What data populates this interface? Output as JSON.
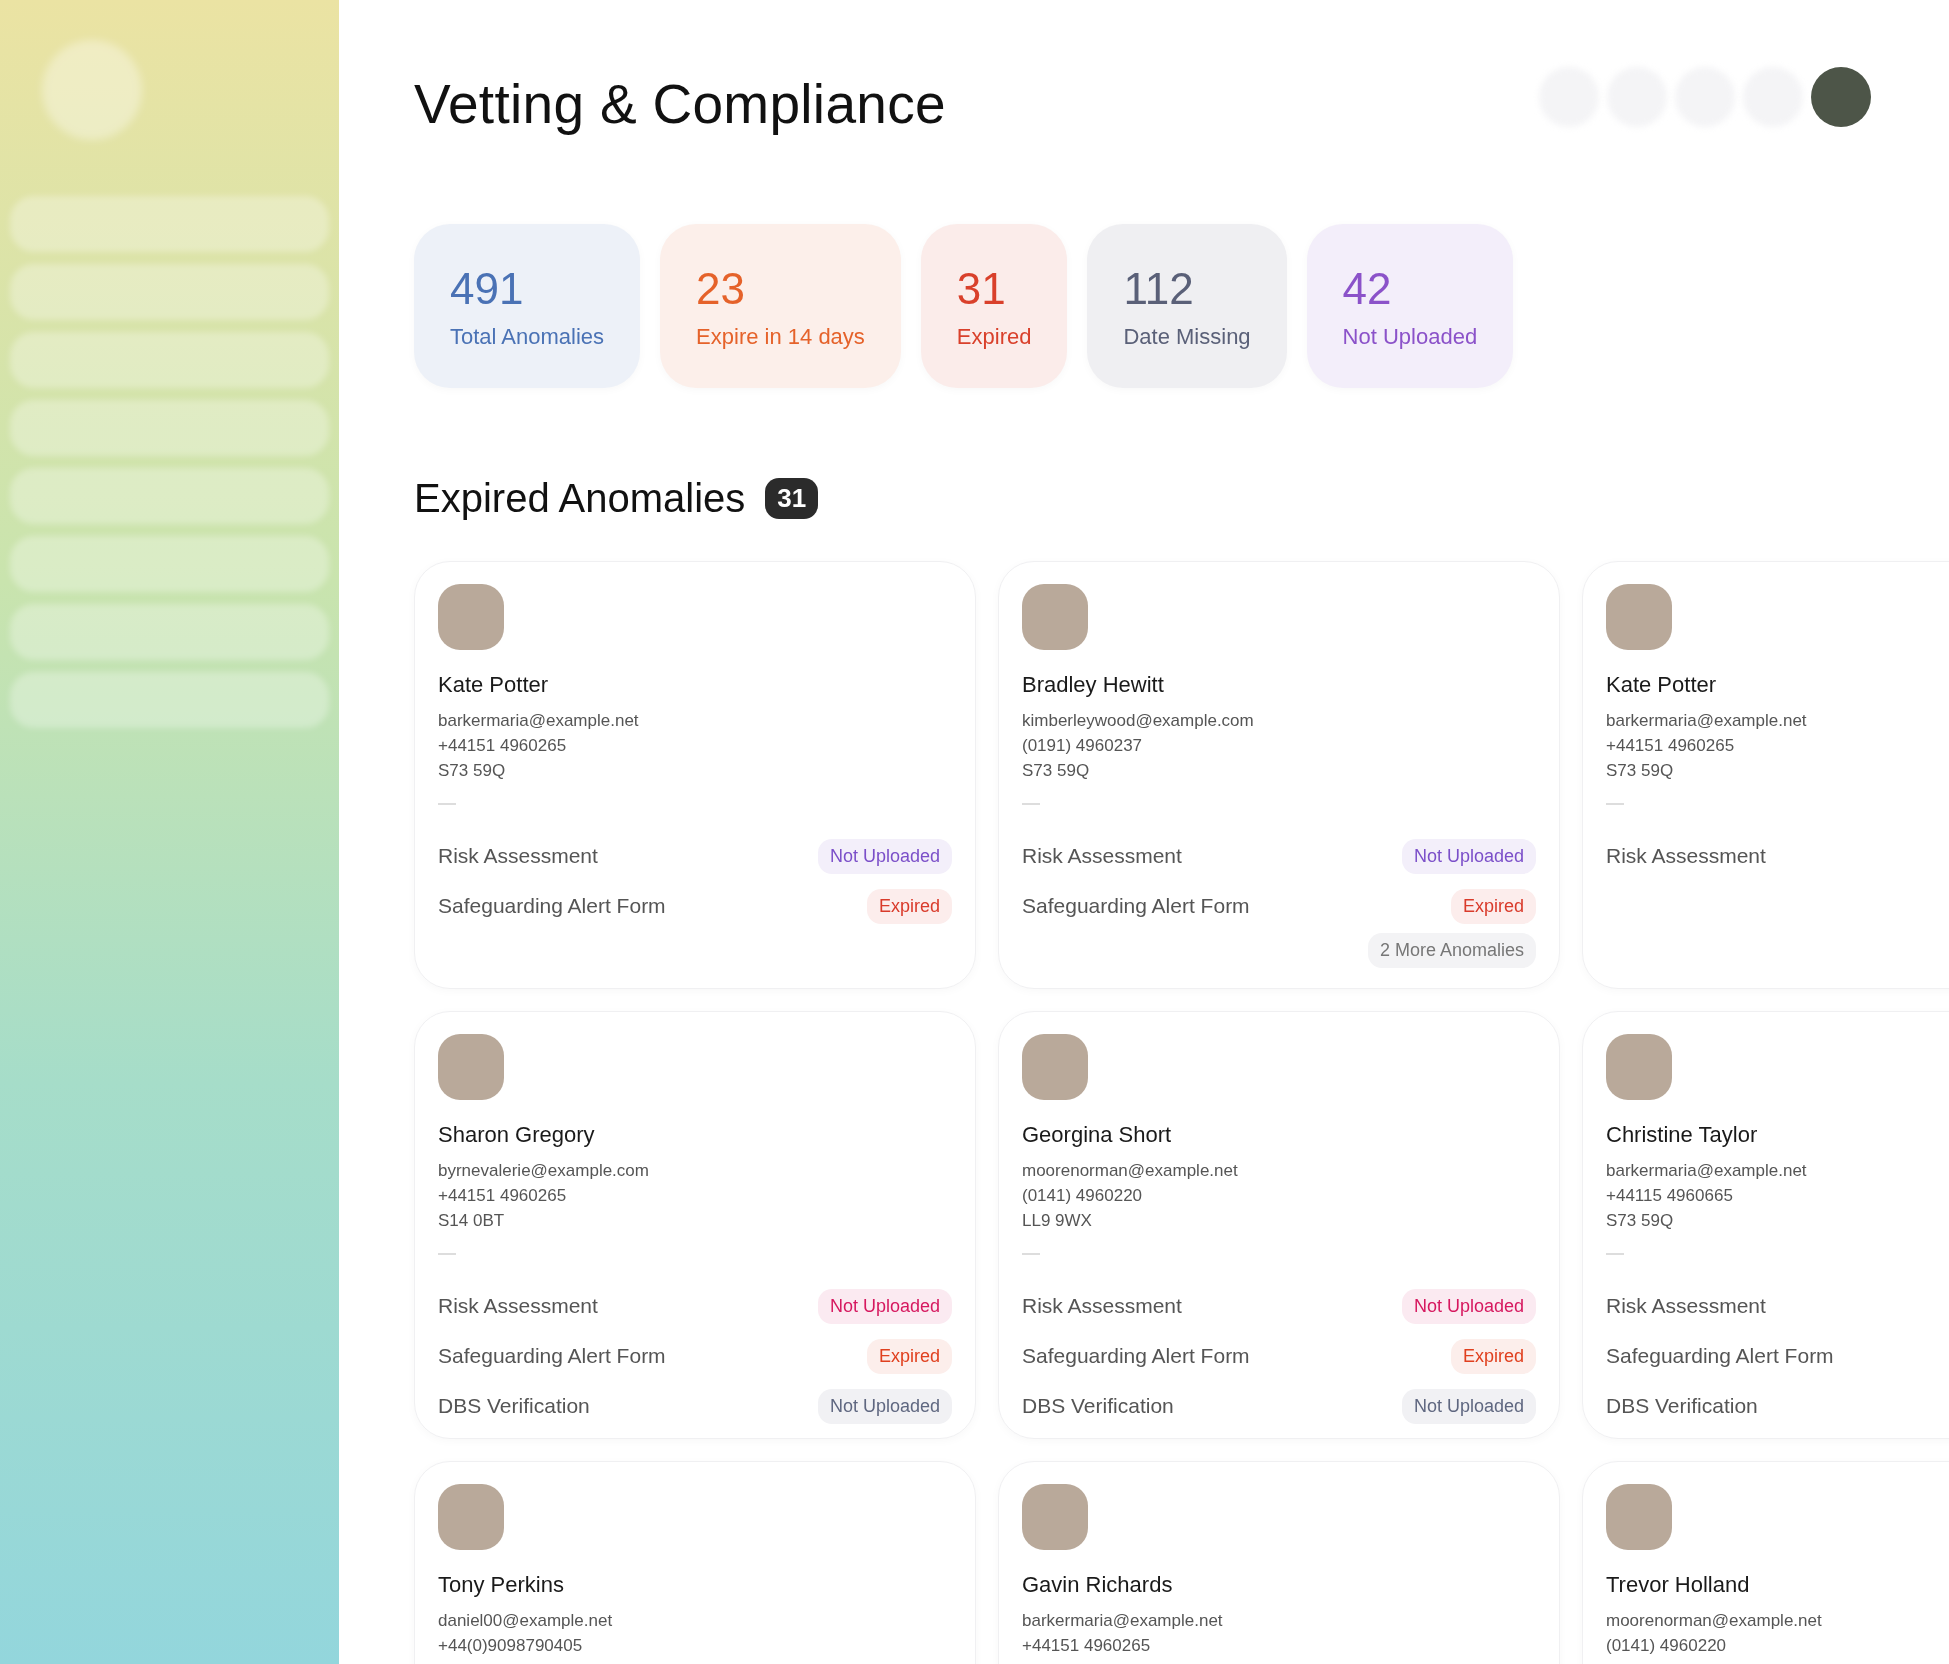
{
  "title": "Vetting & Compliance",
  "stats": [
    {
      "value": "491",
      "label": "Total Anomalies",
      "color": "#4a72b5"
    },
    {
      "value": "23",
      "label": "Expire in 14 days",
      "color": "#e5622a"
    },
    {
      "value": "31",
      "label": "Expired",
      "color": "#d9402b"
    },
    {
      "value": "112",
      "label": "Date Missing",
      "color": "#5a6078"
    },
    {
      "value": "42",
      "label": "Not Uploaded",
      "color": "#8b52c9"
    }
  ],
  "section": {
    "title": "Expired Anomalies",
    "count": "31"
  },
  "cards": [
    {
      "name": "Kate Potter",
      "email": "barkermaria@example.net",
      "phone": "+44151 4960265",
      "postcode": "S73 59Q",
      "items": [
        {
          "label": "Risk Assessment",
          "status": {
            "text": "Not Uploaded",
            "color": "#7b4fc9"
          }
        },
        {
          "label": "Safeguarding Alert Form",
          "status": {
            "text": "Expired",
            "color": "#d93b2b"
          }
        }
      ]
    },
    {
      "name": "Bradley Hewitt",
      "email": "kimberleywood@example.com",
      "phone": "(0191) 4960237",
      "postcode": "S73 59Q",
      "items": [
        {
          "label": "Risk Assessment",
          "status": {
            "text": "Not Uploaded",
            "color": "#7b4fc9"
          }
        },
        {
          "label": "Safeguarding Alert Form",
          "status": {
            "text": "Expired",
            "color": "#d93b2b"
          }
        }
      ],
      "more": "2 More Anomalies"
    },
    {
      "name": "Kate Potter",
      "email": "barkermaria@example.net",
      "phone": "+44151 4960265",
      "postcode": "S73 59Q",
      "items": [
        {
          "label": "Risk Assessment"
        }
      ]
    },
    {
      "name": "Sharon Gregory",
      "email": "byrnevalerie@example.com",
      "phone": "+44151 4960265",
      "postcode": "S14 0BT",
      "items": [
        {
          "label": "Risk Assessment",
          "status": {
            "text": "Not Uploaded",
            "color": "#d6185f"
          }
        },
        {
          "label": "Safeguarding Alert Form",
          "status": {
            "text": "Expired",
            "color": "#e0401f"
          }
        },
        {
          "label": "DBS Verification",
          "status": {
            "text": "Not Uploaded",
            "color": "#5f6780"
          }
        }
      ]
    },
    {
      "name": "Georgina Short",
      "email": "moorenorman@example.net",
      "phone": "(0141) 4960220",
      "postcode": "LL9 9WX",
      "items": [
        {
          "label": "Risk Assessment",
          "status": {
            "text": "Not Uploaded",
            "color": "#d6185f"
          }
        },
        {
          "label": "Safeguarding Alert Form",
          "status": {
            "text": "Expired",
            "color": "#e0401f"
          }
        },
        {
          "label": "DBS Verification",
          "status": {
            "text": "Not Uploaded",
            "color": "#5f6780"
          }
        }
      ]
    },
    {
      "name": "Christine Taylor",
      "email": "barkermaria@example.net",
      "phone": "+44115 4960665",
      "postcode": "S73 59Q",
      "items": [
        {
          "label": "Risk Assessment"
        },
        {
          "label": "Safeguarding Alert Form"
        },
        {
          "label": "DBS Verification"
        }
      ]
    },
    {
      "name": "Tony Perkins",
      "email": "daniel00@example.net",
      "phone": "+44(0)9098790405"
    },
    {
      "name": "Gavin Richards",
      "email": "barkermaria@example.net",
      "phone": "+44151 4960265"
    },
    {
      "name": "Trevor Holland",
      "email": "moorenorman@example.net",
      "phone": "(0141) 4960220"
    }
  ]
}
